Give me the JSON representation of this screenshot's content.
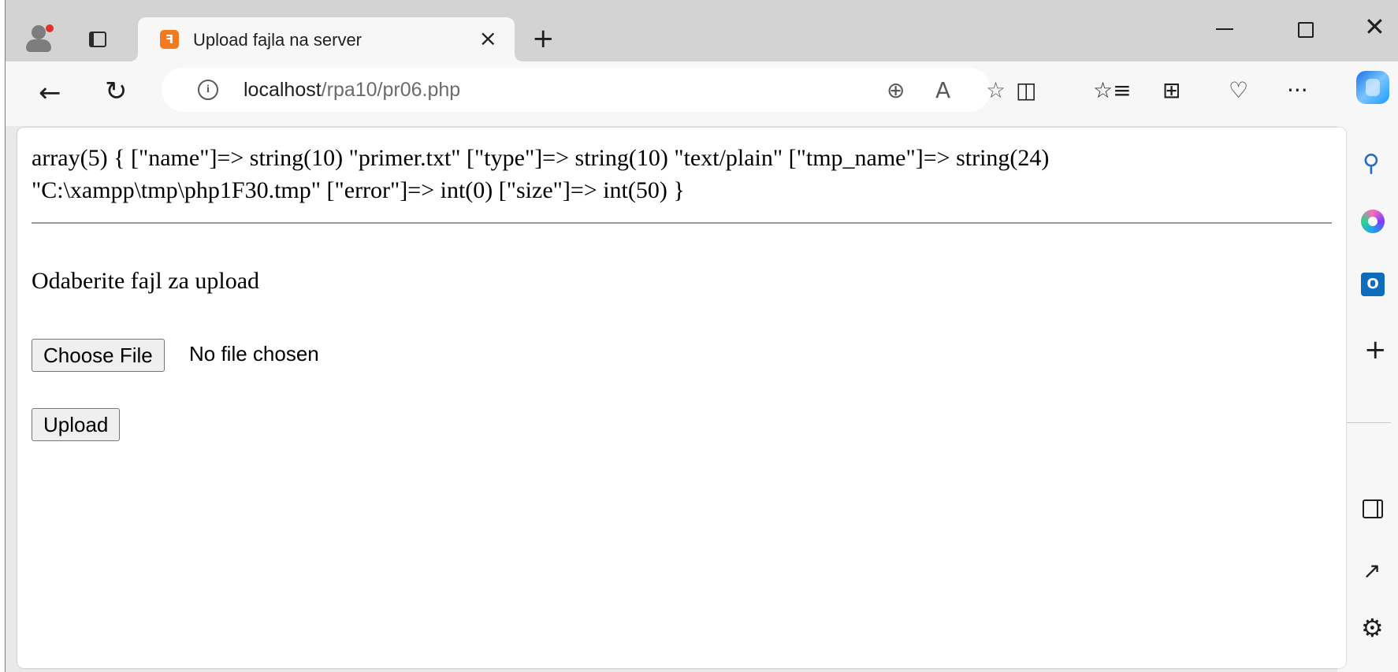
{
  "browser": {
    "tab_title": "Upload fajla na server",
    "tab_favicon": "xampp-icon",
    "url_host": "localhost",
    "url_path": "/rpa10/pr06.php",
    "accent_color": "#f47a20"
  },
  "page": {
    "dump_text": "array(5) { [\"name\"]=> string(10) \"primer.txt\" [\"type\"]=> string(10) \"text/plain\" [\"tmp_name\"]=> string(24) \"C:\\xampp\\tmp\\php1F30.tmp\" [\"error\"]=> int(0) [\"size\"]=> int(50) }",
    "prompt": "Odaberite fajl za upload",
    "choose_file_label": "Choose File",
    "file_status": "No file chosen",
    "upload_label": "Upload"
  },
  "icons": {
    "tab_close": "×",
    "new_tab": "+",
    "window_close": "✕",
    "back": "←",
    "reload": "↻",
    "info": "i",
    "zoom": "⊕",
    "read_aloud": "A",
    "favorite": "☆",
    "split": "◫",
    "favorites_list": "☆≡",
    "collections": "⊞",
    "health": "♡",
    "more": "···",
    "search": "⚲",
    "outlook": "O",
    "sidebar_add": "+",
    "popout": "↗",
    "settings": "⚙"
  }
}
